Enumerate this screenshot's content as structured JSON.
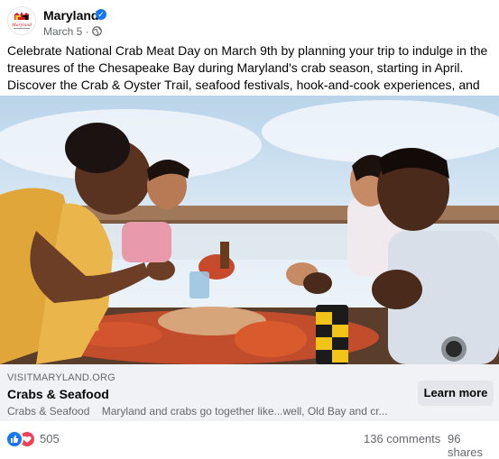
{
  "post": {
    "page_name": "Maryland",
    "date": "March 5",
    "text": "Celebrate National Crab Meat Day on March 9th by planning your trip to indulge in the treasures of the Chesapeake Bay during Maryland's crab season, starting in April. Discover the Crab & Oyster Trail, seafood festivals, hook-and-cook experiences, and more!",
    "avatar_text": "Maryland"
  },
  "link": {
    "domain": "VISITMARYLAND.ORG",
    "title": "Crabs & Seafood",
    "desc_title": "Crabs & Seafood",
    "desc": "Maryland and crabs go together like...well, Old Bay and cr...",
    "cta": "Learn more"
  },
  "stats": {
    "reactions": "505",
    "comments": "136 comments",
    "shares": "96 shares"
  },
  "colors": {
    "verified": "#1877f2",
    "like": "#1877f2",
    "love": "#f33e58",
    "link_box": "#f0f2f5",
    "button": "#e4e6eb"
  },
  "icons": {
    "verified": "verified-badge-icon",
    "audience": "globe-icon",
    "emoji": "crab-emoji-icon",
    "like": "like-reaction-icon",
    "love": "love-reaction-icon"
  }
}
